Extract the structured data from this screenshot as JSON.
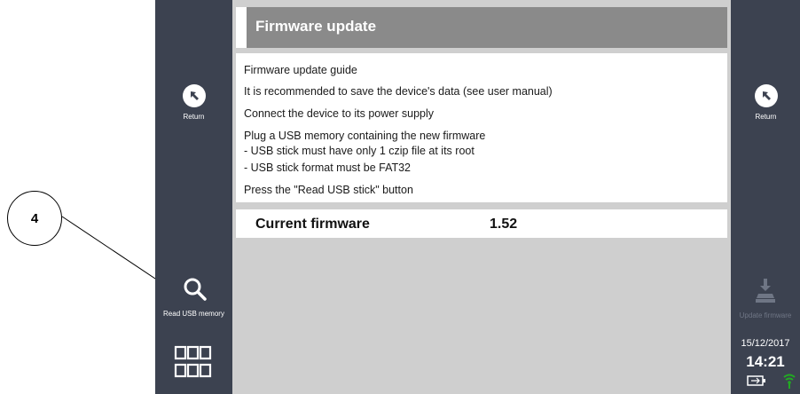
{
  "callout": {
    "number": "4"
  },
  "header": {
    "title": "Firmware update"
  },
  "guide": {
    "lines": [
      "Firmware update guide",
      "It is recommended to save the device's data (see user manual)",
      "Connect the device to its power supply",
      "Plug a USB memory containing the new firmware",
      "- USB stick must have only 1 czip file at its root",
      "- USB stick format must be FAT32",
      "Press the \"Read USB stick\" button"
    ]
  },
  "firmware": {
    "label": "Current firmware",
    "value": "1.52"
  },
  "sidebar_left": {
    "return_label": "Return",
    "read_usb_label": "Read USB memory",
    "icons": {
      "return": "return-arrow-icon",
      "read_usb": "search-icon",
      "menu": "grid-menu-icon"
    }
  },
  "sidebar_right": {
    "return_label": "Return",
    "update_label": "Update firmware",
    "date": "15/12/2017",
    "time": "14:21",
    "icons": {
      "return": "return-arrow-icon",
      "update": "download-tray-icon",
      "battery": "battery-icon",
      "signal": "wifi-signal-icon"
    }
  },
  "colors": {
    "sidebar": "#3c4250",
    "header": "#8a8a8a",
    "content_bg": "#cfcfcf",
    "disabled_text": "#6f7685",
    "signal_green": "#22aa22"
  }
}
